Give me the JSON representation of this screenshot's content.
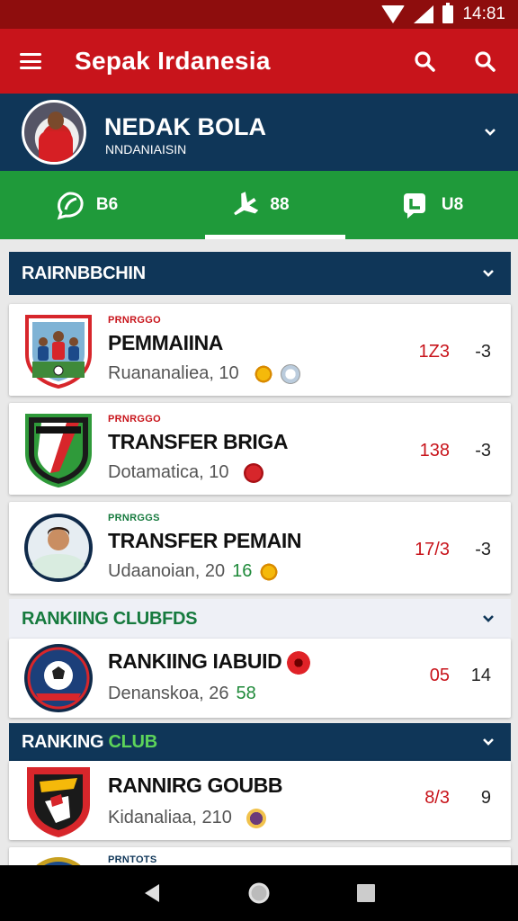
{
  "status": {
    "time": "14:81"
  },
  "app": {
    "title": "Sepak Irdanesia"
  },
  "profile": {
    "name": "NEDAK BOLA",
    "subtitle": "NNDANIAISIN"
  },
  "tabs": [
    {
      "label": "B6",
      "icon": "leaf-chat-icon"
    },
    {
      "label": "88",
      "icon": "plane-icon"
    },
    {
      "label": "U8",
      "icon": "message-icon"
    }
  ],
  "sections": [
    {
      "title": "RAIRNBBCHIN",
      "title_accent": "",
      "style": "dark"
    },
    {
      "title": "RANKIING CLUBFDS",
      "title_accent": "",
      "style": "light"
    },
    {
      "title": "RANKING ",
      "title_accent": "CLUB",
      "style": "dark"
    }
  ],
  "cards": [
    {
      "kicker": "PRNRGGO",
      "title": "PEMMAIINA",
      "meta": "Ruananaliea, 10",
      "meta2": "",
      "stat": "1Z3",
      "stat2": "-3",
      "logo": "team-photo-shield-icon",
      "badges": [
        "sun",
        "ball"
      ]
    },
    {
      "kicker": "PRNRGGO",
      "title": "TRANSFER BRIGA",
      "meta": "Dotamatica, 10",
      "meta2": "",
      "stat": "138",
      "stat2": "-3",
      "logo": "green-shield-icon",
      "badges": [
        "red"
      ]
    },
    {
      "kicker": "PRNRGGS",
      "title": "TRANSFER PEMAIN",
      "meta": "Udaanoian, 20",
      "meta2": "16",
      "stat": "17/3",
      "stat2": "-3",
      "logo": "player-avatar-icon",
      "badges": [
        "sun"
      ]
    },
    {
      "kicker": "",
      "title": "RANKIING IABUID",
      "meta": "Denanskoa, 26",
      "meta2": "58",
      "stat": "05",
      "stat2": "14",
      "logo": "ball-crest-icon",
      "badges": [
        "redbig"
      ]
    },
    {
      "kicker": "",
      "title": "RANNIRG GOUBB",
      "meta": "Kidanaliaa, 210",
      "meta2": "",
      "stat": "8/3",
      "stat2": "9",
      "logo": "red-black-shield-icon",
      "badges": [
        "purple"
      ]
    },
    {
      "kicker": "PRNTOTS",
      "title": "",
      "meta": "",
      "meta2": "",
      "stat": "",
      "stat2": "",
      "logo": "blue-crest-icon",
      "badges": []
    }
  ],
  "colors": {
    "status_bar": "#8e0d0d",
    "app_bar": "#c8141b",
    "navy": "#0f3658",
    "green": "#1f9a3a",
    "stat_red": "#c8141b"
  }
}
